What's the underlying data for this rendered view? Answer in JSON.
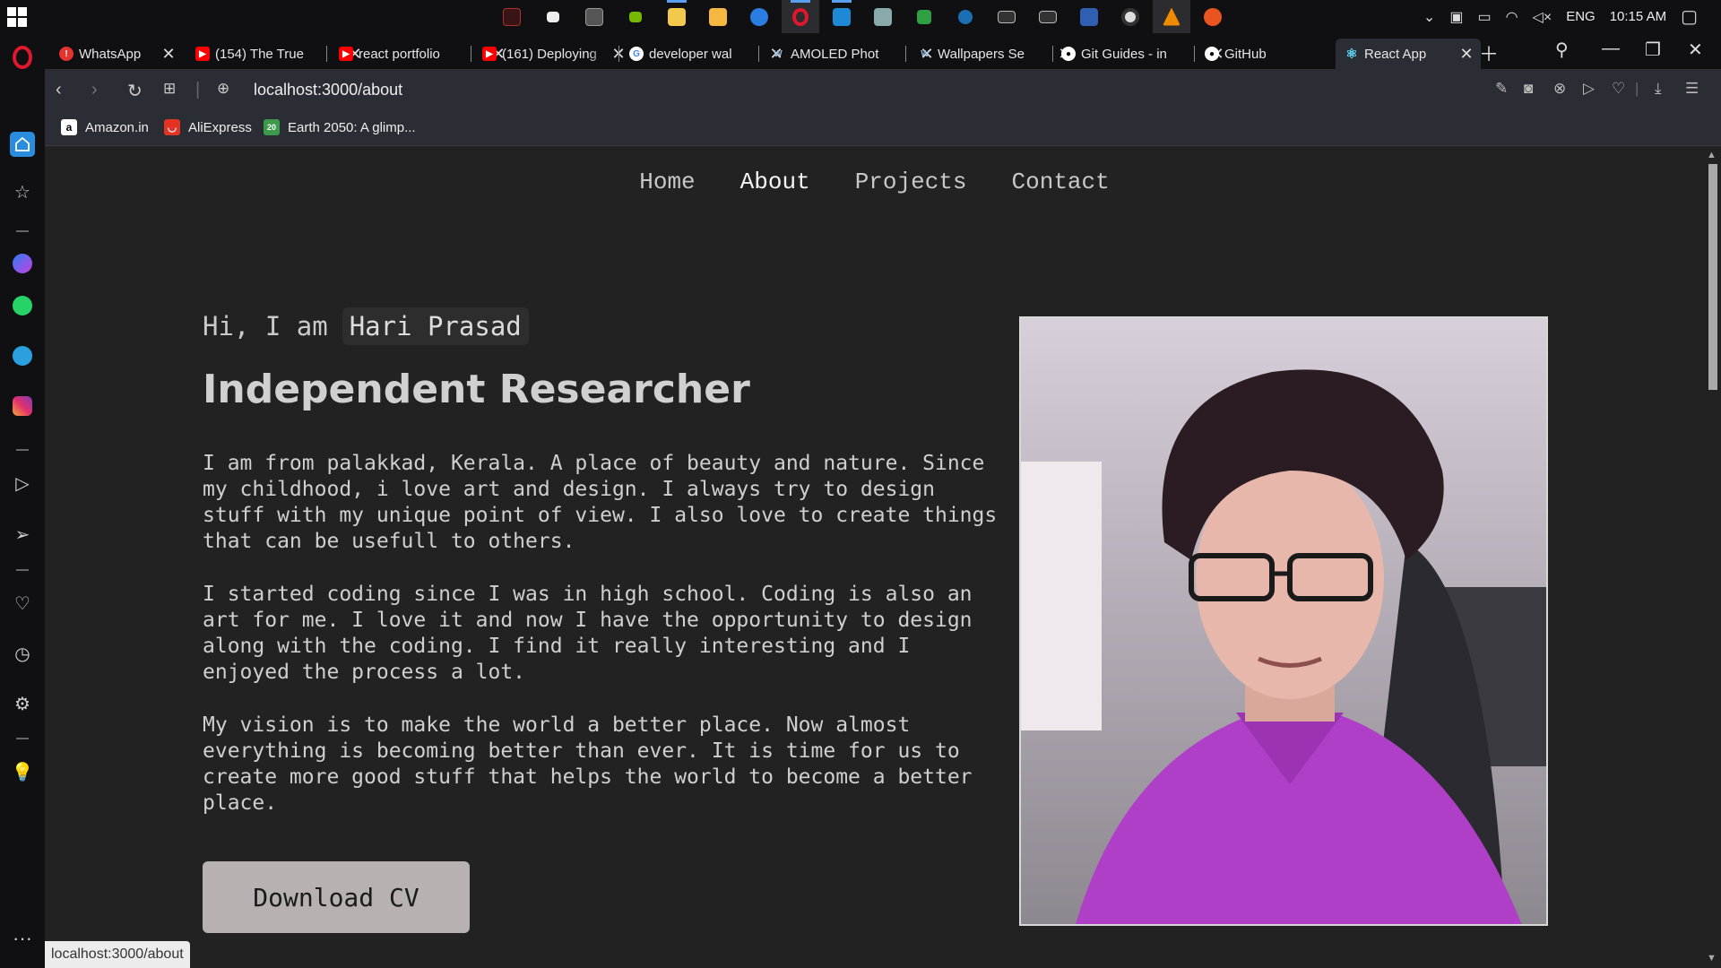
{
  "taskbar": {
    "tray": {
      "language": "ENG",
      "time": "10:15 AM"
    }
  },
  "tabs": [
    {
      "title": "WhatsApp",
      "favicon": "whatsapp-alert-icon",
      "color": "#e3342f"
    },
    {
      "title": "(154) The True",
      "favicon": "youtube-icon",
      "color": "#ff0000"
    },
    {
      "title": "react portfolio",
      "favicon": "youtube-icon",
      "color": "#ff0000"
    },
    {
      "title": "(161) Deploying",
      "favicon": "youtube-icon",
      "color": "#ff0000"
    },
    {
      "title": "developer wal",
      "favicon": "google-icon",
      "color": "#ffffff"
    },
    {
      "title": "AMOLED Phot",
      "favicon": "wallhaven-icon",
      "color": "#9ab"
    },
    {
      "title": "Wallpapers Se",
      "favicon": "wallhaven-icon",
      "color": "#9ab"
    },
    {
      "title": "Git Guides - in",
      "favicon": "github-icon",
      "color": "#ffffff"
    },
    {
      "title": "GitHub",
      "favicon": "github-icon",
      "color": "#ffffff"
    },
    {
      "title": "React App",
      "favicon": "react-icon",
      "color": "#61dafb",
      "active": true
    }
  ],
  "addressbar": {
    "url": "localhost:3000/about"
  },
  "bookmarks": [
    {
      "label": "Amazon.in",
      "icon": "amazon-icon"
    },
    {
      "label": "AliExpress",
      "icon": "aliexpress-icon"
    },
    {
      "label": "Earth 2050: A glimp...",
      "icon": "earth2050-icon"
    }
  ],
  "site": {
    "nav": [
      {
        "label": "Home"
      },
      {
        "label": "About",
        "current": true
      },
      {
        "label": "Projects"
      },
      {
        "label": "Contact"
      }
    ],
    "intro_prefix": "Hi, I am",
    "name": "Hari Prasad",
    "role": "Independent Researcher",
    "paragraphs": [
      "I am from palakkad, Kerala. A place of beauty and nature. Since my childhood, i love art and design. I always try to design stuff with my unique point of view. I also love to create things that can be usefull to others.",
      "I started coding since I was in high school. Coding is also an art for me. I love it and now I have the opportunity to design along with the coding. I find it really interesting and I enjoyed the process a lot.",
      "My vision is to make the world a better place. Now almost everything is becoming better than ever. It is time for us to create more good stuff that helps the world to become a better place."
    ],
    "cv_button": "Download CV"
  },
  "status_bar": {
    "hover_url": "localhost:3000/about"
  }
}
